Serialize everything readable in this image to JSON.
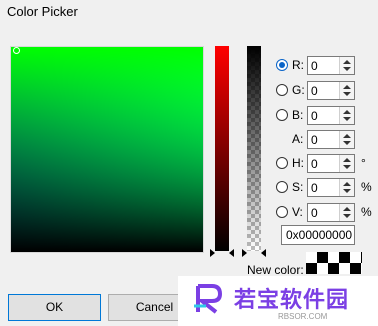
{
  "window": {
    "title": "Color Picker"
  },
  "channels": [
    {
      "key": "R",
      "label": "R:",
      "value": "0",
      "unit": "",
      "radio": true,
      "checked": true
    },
    {
      "key": "G",
      "label": "G:",
      "value": "0",
      "unit": "",
      "radio": true,
      "checked": false
    },
    {
      "key": "B",
      "label": "B:",
      "value": "0",
      "unit": "",
      "radio": true,
      "checked": false
    },
    {
      "key": "A",
      "label": "A:",
      "value": "0",
      "unit": "",
      "radio": false,
      "checked": false
    },
    {
      "key": "H",
      "label": "H:",
      "value": "0",
      "unit": "°",
      "radio": true,
      "checked": false
    },
    {
      "key": "S",
      "label": "S:",
      "value": "0",
      "unit": "%",
      "radio": true,
      "checked": false
    },
    {
      "key": "V",
      "label": "V:",
      "value": "0",
      "unit": "%",
      "radio": true,
      "checked": false
    }
  ],
  "hex": {
    "value": "0x00000000"
  },
  "new_color": {
    "label": "New color:"
  },
  "buttons": {
    "ok": "OK",
    "cancel": "Cancel"
  },
  "watermark": {
    "text": "若宝软件园",
    "sub": "RBSOR.COM"
  },
  "colors": {
    "accent": "#0078d7",
    "watermark": "#7b3fe4"
  }
}
